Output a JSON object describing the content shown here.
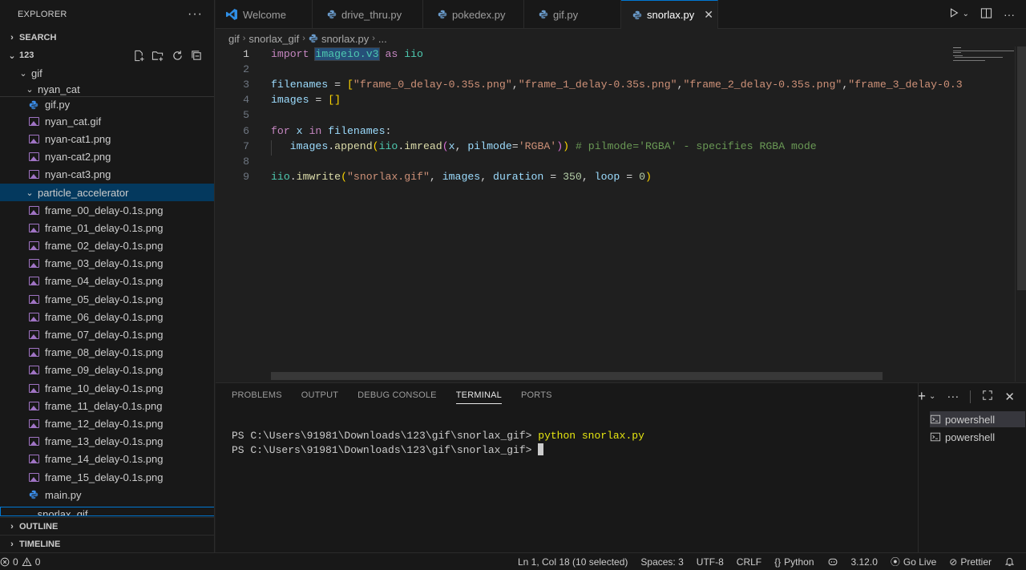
{
  "sidebar": {
    "title": "EXPLORER",
    "more": "···",
    "search_section": "SEARCH",
    "root": "123",
    "folder_gif": "gif",
    "folder_nyan": "nyan_cat",
    "nyan_files": [
      "gif.py",
      "nyan_cat.gif",
      "nyan-cat1.png",
      "nyan-cat2.png",
      "nyan-cat3.png"
    ],
    "folder_particle": "particle_accelerator",
    "particle_files": [
      "frame_00_delay-0.1s.png",
      "frame_01_delay-0.1s.png",
      "frame_02_delay-0.1s.png",
      "frame_03_delay-0.1s.png",
      "frame_04_delay-0.1s.png",
      "frame_05_delay-0.1s.png",
      "frame_06_delay-0.1s.png",
      "frame_07_delay-0.1s.png",
      "frame_08_delay-0.1s.png",
      "frame_09_delay-0.1s.png",
      "frame_10_delay-0.1s.png",
      "frame_11_delay-0.1s.png",
      "frame_12_delay-0.1s.png",
      "frame_13_delay-0.1s.png",
      "frame_14_delay-0.1s.png",
      "frame_15_delay-0.1s.png"
    ],
    "main_file": "main.py",
    "folder_snorlax": "snorlax_gif",
    "outline": "OUTLINE",
    "timeline": "TIMELINE"
  },
  "tabs": [
    {
      "label": "Welcome",
      "icon": "vscode-icon"
    },
    {
      "label": "drive_thru.py",
      "icon": "python-icon"
    },
    {
      "label": "pokedex.py",
      "icon": "python-icon"
    },
    {
      "label": "gif.py",
      "icon": "python-icon"
    },
    {
      "label": "snorlax.py",
      "icon": "python-icon",
      "active": true
    }
  ],
  "breadcrumb": [
    "gif",
    "snorlax_gif",
    "snorlax.py",
    "..."
  ],
  "editor": {
    "line_numbers": [
      "1",
      "2",
      "3",
      "4",
      "5",
      "6",
      "7",
      "8",
      "9"
    ],
    "l1": {
      "import": "import",
      "module": "imageio.v3",
      "as": "as",
      "alias": "iio"
    },
    "l3": {
      "var": "filenames",
      "eq": " = ",
      "open": "[",
      "s0": "\"frame_0_delay-0.35s.png\"",
      "c": ",",
      "s1": "\"frame_1_delay-0.35s.png\"",
      "s2": "\"frame_2_delay-0.35s.png\"",
      "s3": "\"frame_3_delay-0.3"
    },
    "l4": {
      "var": "images",
      "eq": " = ",
      "brackets": "[]"
    },
    "l6": {
      "for": "for",
      "x": "x",
      "in": "in",
      "iter": "filenames",
      "colon": ":"
    },
    "l7": {
      "obj": "images",
      "dot": ".",
      "fn": "append",
      "p1": "(",
      "mod": "iio",
      "fn2": "imread",
      "p2": "(",
      "x": "x",
      "comma": ", ",
      "kw": "pilmode",
      "eq": "=",
      "str": "'RGBA'",
      "close2": ")",
      "close1": ")",
      "comment": "# pilmode='RGBA' - specifies RGBA mode"
    },
    "l9": {
      "mod": "iio",
      "dot": ".",
      "fn": "imwrite",
      "p": "(",
      "s": "\"snorlax.gif\"",
      "c1": ", ",
      "images": "images",
      "c2": ", ",
      "dur": "duration",
      "eq1": " = ",
      "n1": "350",
      "c3": ", ",
      "loop": "loop",
      "eq2": " = ",
      "n2": "0",
      "close": ")"
    }
  },
  "panel": {
    "tabs": [
      "PROBLEMS",
      "OUTPUT",
      "DEBUG CONSOLE",
      "TERMINAL",
      "PORTS"
    ],
    "active_tab": "TERMINAL",
    "terminal": {
      "line1_prompt": "PS C:\\Users\\91981\\Downloads\\123\\gif\\snorlax_gif> ",
      "line1_cmd": "python snorlax.py",
      "line2_prompt": "PS C:\\Users\\91981\\Downloads\\123\\gif\\snorlax_gif> "
    },
    "terminals": [
      "powershell",
      "powershell"
    ]
  },
  "status": {
    "errors": "0",
    "warnings": "0",
    "position": "Ln 1, Col 18 (10 selected)",
    "spaces": "Spaces: 3",
    "encoding": "UTF-8",
    "eol": "CRLF",
    "language": "Python",
    "python_version": "3.12.0",
    "golive": "Go Live",
    "prettier": "Prettier"
  },
  "colors": {
    "accent": "#0078d4",
    "selection": "#04395e",
    "image_icon": "#a074c4",
    "python_icon": "#3b8eea"
  }
}
